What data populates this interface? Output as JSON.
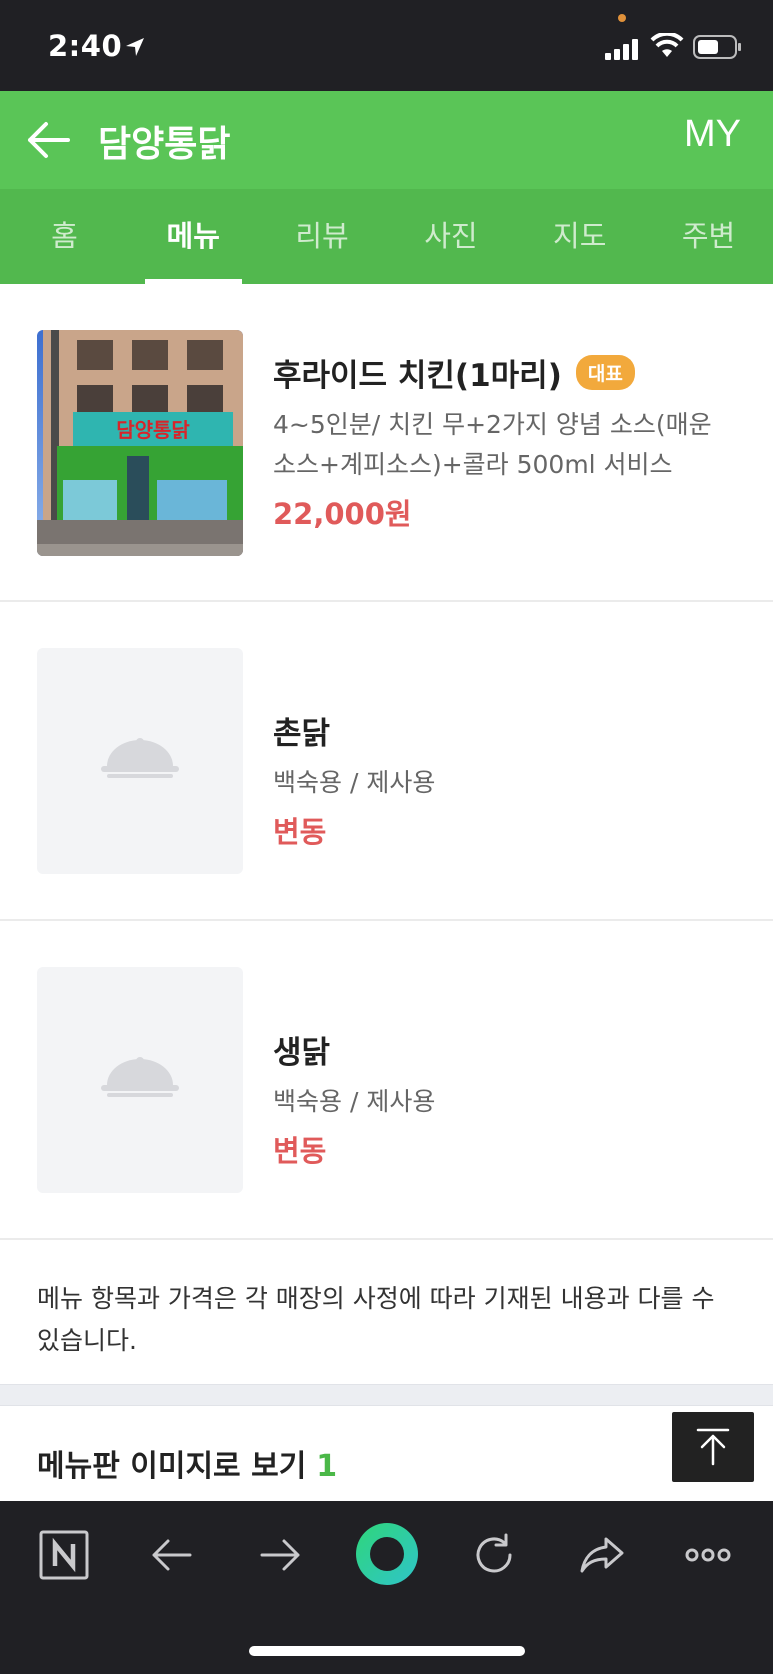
{
  "status_bar": {
    "time": "2:40"
  },
  "header": {
    "title": "담양통닭",
    "my_label": "MY"
  },
  "tabs": [
    {
      "label": "홈",
      "active": false
    },
    {
      "label": "메뉴",
      "active": true
    },
    {
      "label": "리뷰",
      "active": false
    },
    {
      "label": "사진",
      "active": false
    },
    {
      "label": "지도",
      "active": false
    },
    {
      "label": "주변",
      "active": false
    }
  ],
  "menu": {
    "items": [
      {
        "name": "후라이드 치킨(1마리)",
        "badge": "대표",
        "desc": "4~5인분/ 치킨 무+2가지 양념 소스(매운소스+계피소스)+콜라 500ml 서비스",
        "price": "22,000원",
        "has_photo": true
      },
      {
        "name": "촌닭",
        "badge": "",
        "desc": "백숙용 / 제사용",
        "price": "변동",
        "has_photo": false
      },
      {
        "name": "생닭",
        "badge": "",
        "desc": "백숙용 / 제사용",
        "price": "변동",
        "has_photo": false
      }
    ]
  },
  "notice": "메뉴 항목과 가격은 각 매장의 사정에 따라 기재된 내용과 다를 수 있습니다.",
  "menupan": {
    "label": "메뉴판 이미지로 보기",
    "count": "1"
  },
  "colors": {
    "header": "#5ac557",
    "tabs": "#52b84e",
    "price": "#e05a5a",
    "badge": "#f2a93c"
  },
  "photo_sign": {
    "text": "담양통닭"
  },
  "browser_bar": {
    "icons": [
      "naver-n-icon",
      "back-arrow-icon",
      "forward-arrow-icon",
      "green-dot-icon",
      "refresh-icon",
      "share-icon",
      "more-icon"
    ]
  }
}
